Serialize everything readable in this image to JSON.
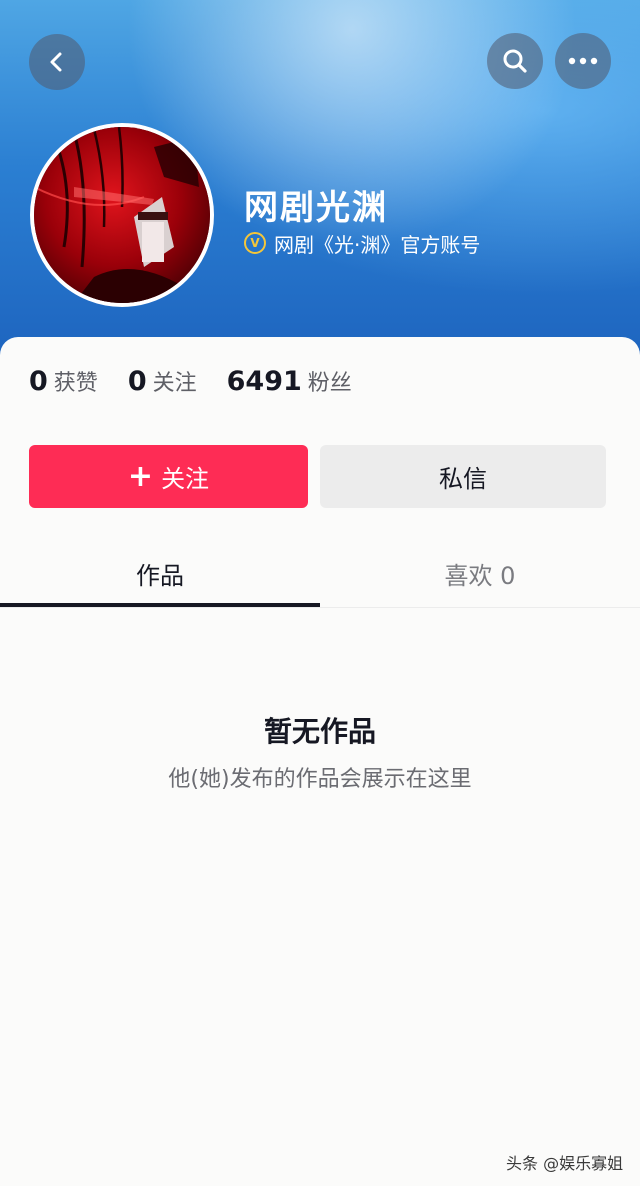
{
  "profile": {
    "name": "网剧光渊",
    "verification": "网剧《光·渊》官方账号",
    "verify_badge": "V"
  },
  "stats": [
    {
      "value": "0",
      "label": "获赞"
    },
    {
      "value": "0",
      "label": "关注"
    },
    {
      "value": "6491",
      "label": "粉丝"
    }
  ],
  "actions": {
    "follow_icon": "+",
    "follow_label": "关注",
    "message_label": "私信"
  },
  "tabs": [
    {
      "label": "作品",
      "active": true
    },
    {
      "label": "喜欢 0",
      "active": false
    }
  ],
  "empty_state": {
    "title": "暂无作品",
    "subtitle": "他(她)发布的作品会展示在这里"
  },
  "watermark": "头条 @娱乐寡姐",
  "icons": {
    "back": "chevron-left-icon",
    "search": "search-icon",
    "more": "more-horizontal-icon"
  },
  "colors": {
    "accent": "#fe2c55",
    "header": "#2b7fd2",
    "verify": "#f4c63a"
  }
}
